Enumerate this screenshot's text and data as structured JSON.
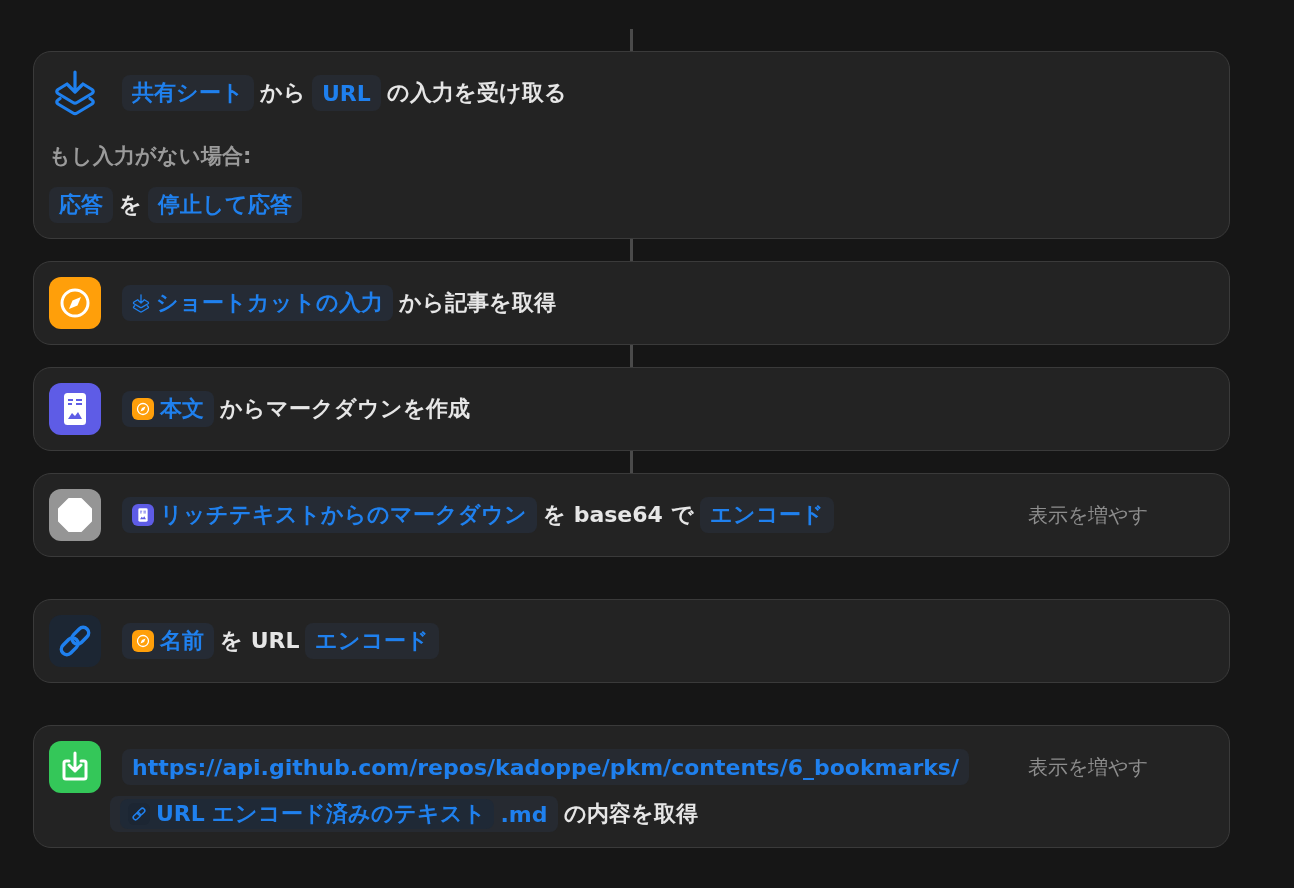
{
  "actions": [
    {
      "kind": "receive-input",
      "connected": true,
      "lines": [
        [
          {
            "kind": "param",
            "text": "共有シート"
          },
          {
            "kind": "text",
            "text": "から"
          },
          {
            "kind": "param",
            "text": "URL"
          },
          {
            "kind": "text",
            "text": "の入力を受け取る"
          }
        ]
      ],
      "fallback": {
        "label": "もし入力がない場合:",
        "parts": [
          {
            "kind": "param",
            "text": "応答"
          },
          {
            "kind": "text",
            "text": "を"
          },
          {
            "kind": "param",
            "text": "停止して応答"
          }
        ]
      }
    },
    {
      "kind": "get-article",
      "connected": true,
      "lines": [
        [
          {
            "kind": "variable",
            "source": {
              "kind": "receive-input"
            },
            "text": "ショートカットの入力"
          },
          {
            "kind": "text",
            "text": "から記事を取得"
          }
        ]
      ]
    },
    {
      "kind": "make-markdown",
      "connected": true,
      "lines": [
        [
          {
            "kind": "variable",
            "source": {
              "kind": "get-article"
            },
            "text": "本文"
          },
          {
            "kind": "text",
            "text": "からマークダウンを作成"
          }
        ]
      ]
    },
    {
      "kind": "encode",
      "connected": true,
      "lines": [
        [
          {
            "kind": "variable",
            "source": {
              "kind": "make-markdown"
            },
            "text": "リッチテキストからのマークダウン"
          },
          {
            "kind": "text",
            "text": "を base64 で"
          },
          {
            "kind": "param",
            "text": "エンコード"
          }
        ]
      ],
      "more": "表示を増やす"
    },
    {
      "kind": "url-encode",
      "connected": false,
      "lines": [
        [
          {
            "kind": "variable",
            "source": {
              "kind": "get-article"
            },
            "text": "名前"
          },
          {
            "kind": "text",
            "text": "を URL"
          },
          {
            "kind": "param",
            "text": "エンコード"
          }
        ]
      ]
    },
    {
      "kind": "get-contents",
      "connected": false,
      "lines": [
        [
          {
            "kind": "param",
            "text": "https://api.github.com/repos/kadoppe/pkm/contents/6_bookmarks/"
          }
        ],
        [
          {
            "kind": "param",
            "variable": {
              "source": {
                "kind": "url-encode"
              },
              "text": "URL エンコード済みのテキスト"
            },
            "text": ".md"
          },
          {
            "kind": "text",
            "text": "の内容を取得"
          }
        ]
      ],
      "more": "表示を増やす"
    }
  ]
}
